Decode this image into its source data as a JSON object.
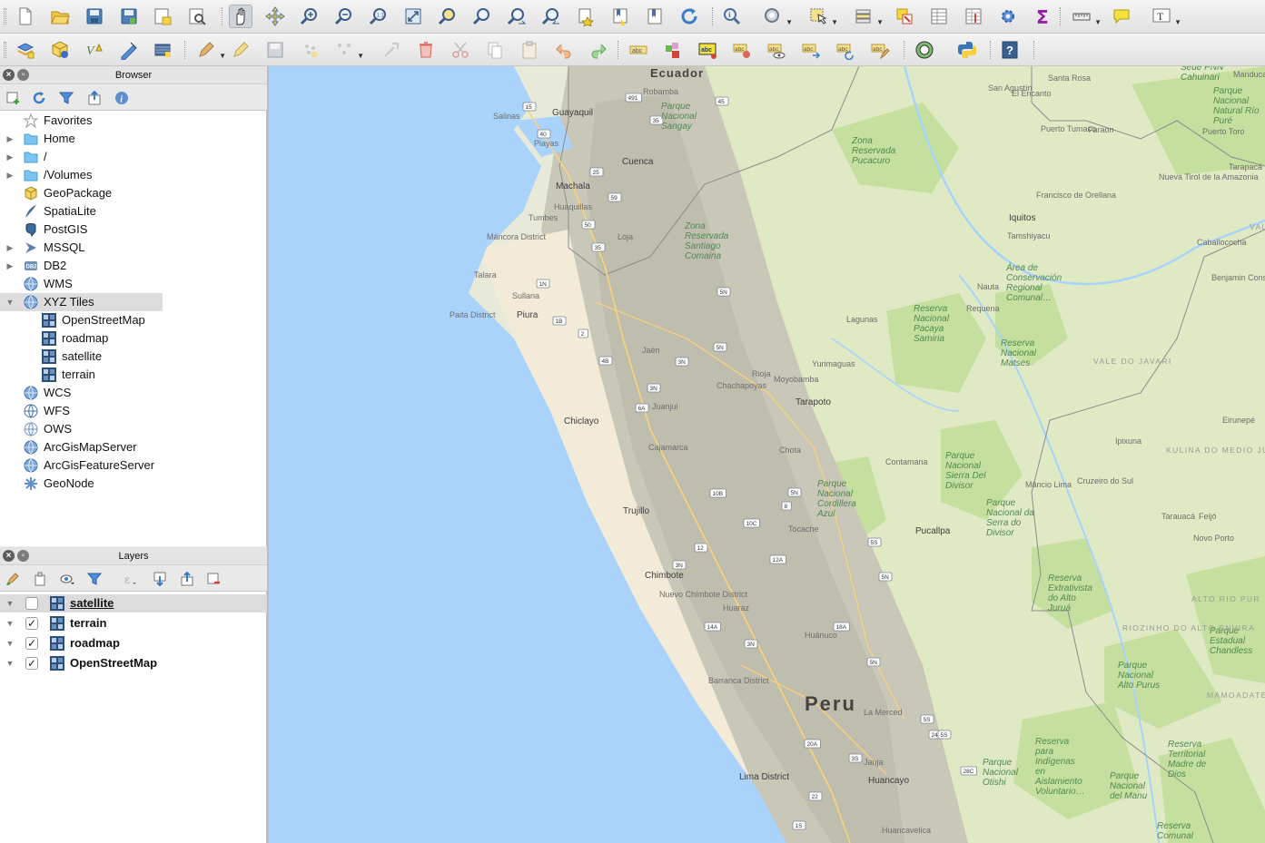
{
  "browser_panel": {
    "title": "Browser",
    "items": [
      {
        "label": "Favorites",
        "icon": "star-icon",
        "expandable": false
      },
      {
        "label": "Home",
        "icon": "folder-icon",
        "expandable": true
      },
      {
        "label": "/",
        "icon": "folder-icon",
        "expandable": true
      },
      {
        "label": "/Volumes",
        "icon": "folder-icon",
        "expandable": true
      },
      {
        "label": "GeoPackage",
        "icon": "geopackage-icon",
        "expandable": false
      },
      {
        "label": "SpatiaLite",
        "icon": "spatialite-icon",
        "expandable": false
      },
      {
        "label": "PostGIS",
        "icon": "postgis-icon",
        "expandable": false
      },
      {
        "label": "MSSQL",
        "icon": "mssql-icon",
        "expandable": true
      },
      {
        "label": "DB2",
        "icon": "db2-icon",
        "expandable": true
      },
      {
        "label": "WMS",
        "icon": "globe-icon",
        "expandable": false
      },
      {
        "label": "XYZ Tiles",
        "icon": "globe-icon",
        "expandable": true,
        "expanded": true,
        "selected": true
      },
      {
        "label": "OpenStreetMap",
        "icon": "tile-layer-icon",
        "child": true
      },
      {
        "label": "roadmap",
        "icon": "tile-layer-icon",
        "child": true
      },
      {
        "label": "satellite",
        "icon": "tile-layer-icon",
        "child": true
      },
      {
        "label": "terrain",
        "icon": "tile-layer-icon",
        "child": true
      },
      {
        "label": "WCS",
        "icon": "globe-icon",
        "expandable": false
      },
      {
        "label": "WFS",
        "icon": "globe-icon",
        "expandable": false
      },
      {
        "label": "OWS",
        "icon": "globe-icon",
        "expandable": false
      },
      {
        "label": "ArcGisMapServer",
        "icon": "globe-icon",
        "expandable": false
      },
      {
        "label": "ArcGisFeatureServer",
        "icon": "globe-icon",
        "expandable": false
      },
      {
        "label": "GeoNode",
        "icon": "geonode-icon",
        "expandable": false
      }
    ]
  },
  "layers_panel": {
    "title": "Layers",
    "layers": [
      {
        "label": "satellite",
        "checked": false,
        "selected": true
      },
      {
        "label": "terrain",
        "checked": true,
        "selected": false
      },
      {
        "label": "roadmap",
        "checked": true,
        "selected": false
      },
      {
        "label": "OpenStreetMap",
        "checked": true,
        "selected": false
      }
    ]
  },
  "map": {
    "country_label": "Peru",
    "country_label_north": "Ecuador",
    "colors": {
      "ocean": "#aad3fb",
      "land": "#e8ead9",
      "forest": "#c5df9e",
      "mountains": "#c9c7b8",
      "desert": "#f1ebd7"
    },
    "cities": [
      "Guayaquil",
      "Salinas",
      "Playas",
      "Cuenca",
      "Machala",
      "Tumbes",
      "Máncora District",
      "Talara",
      "Sullana",
      "Piura",
      "Paita District",
      "Loja",
      "Jaén",
      "Chiclayo",
      "Cajamarca",
      "Chachapoyas",
      "Moyobamba",
      "Tarapoto",
      "Rioja",
      "Trujillo",
      "Chimbote",
      "Nuevo Chimbote District",
      "Huaraz",
      "Huánuco",
      "Barranca District",
      "Lima District",
      "Huancayo",
      "Jauja",
      "La Merced",
      "Huancavelica",
      "Iquitos",
      "Nauta",
      "Requena",
      "Lagunas",
      "Yurimaguas",
      "Juanjuí",
      "Contamana",
      "Pucallpa",
      "Tocache",
      "Santa Rosa",
      "San Agustín",
      "El Encanto",
      "Puerto Tumaco",
      "Faraon",
      "Francisco de Orellana",
      "Nueva Tirol de la Amazonia",
      "Tamshiyacu",
      "Caballococha",
      "Benjamin Constant",
      "Tarapacá",
      "Puerto Toro",
      "Manduca",
      "Eirunepé",
      "Ipixuna",
      "Mâncio Lima",
      "Cruzeiro do Sul",
      "Tarauacá",
      "Feijó",
      "Novo Porto",
      "Robamba",
      "Huaquillas",
      "Chota",
      "Juanjui"
    ],
    "parks": [
      "Parque Nacional Sangay",
      "Zona Reservada Pucacuro",
      "Zona Reservada Santiago Comaina",
      "Reserva Nacional Pacaya Samiria",
      "Reserva Nacional Matses",
      "Área de Conservación Regional Comunal…",
      "Parque Nacional Cordillera Azul",
      "Parque Nacional Sierra Del Divisor",
      "Parque Nacional da Serra do Divisor",
      "Reserva Extrativista do Alto Juruá",
      "Parque Estadual Chandless",
      "Parque Nacional Alto Purus",
      "Reserva para Indígenas en Aislamiento Voluntario…",
      "Parque Nacional Otishi",
      "Reserva Territorial Madre de Dios",
      "Parque Nacional del Manu",
      "Reserva Comunal",
      "Seue PNN Cahuinari",
      "Parque Nacional Natural Río Puré"
    ],
    "regions": [
      "VALE DO JAVARI",
      "KULINA DO MEDIO JURUA",
      "ALTO RIO PUR",
      "RIOZINHO DO ALTO ENVIRA",
      "MAMOADATE",
      "VAL"
    ],
    "road_shields": [
      "15",
      "40",
      "491",
      "35",
      "45",
      "25",
      "59",
      "50",
      "35",
      "1N",
      "1B",
      "2",
      "5N",
      "3N",
      "4B",
      "6A",
      "3N",
      "5N",
      "10B",
      "10C",
      "12A",
      "12",
      "3N",
      "14A",
      "18A",
      "3N",
      "5N",
      "5N",
      "5S",
      "24A",
      "5S",
      "20A",
      "3S",
      "22",
      "28C",
      "5N",
      "5S",
      "1S",
      "8"
    ]
  },
  "toolbar": {
    "row1": [
      "new-project-icon",
      "open-project-icon",
      "save-project-icon",
      "save-as-icon",
      "new-print-layout-icon",
      "layout-manager-icon",
      "pan-map-icon",
      "pan-to-selection-icon",
      "zoom-in-icon",
      "zoom-out-icon",
      "zoom-native-icon",
      "zoom-full-icon",
      "zoom-to-selection-icon",
      "zoom-to-layer-icon",
      "zoom-last-icon",
      "zoom-next-icon",
      "new-spatial-bookmark-icon",
      "show-bookmarks-icon",
      "show-bookmarks-panel-icon",
      "refresh-icon",
      "identify-icon",
      "run-action-icon",
      "select-features-icon",
      "select-by-value-icon",
      "deselect-icon",
      "attribute-table-icon",
      "field-calculator-icon",
      "processing-toolbox-icon",
      "statistical-summary-icon",
      "measure-line-icon",
      "map-tips-icon",
      "text-annotation-icon"
    ],
    "row2": [
      "data-source-manager-icon",
      "new-geopackage-layer-icon",
      "new-shapefile-layer-icon",
      "new-temporary-layer-icon",
      "new-virtual-layer-icon",
      "digitize-icon",
      "toggle-editing-icon",
      "save-edits-icon",
      "add-feature-icon",
      "vertex-tool-icon",
      "modify-attributes-icon",
      "delete-selected-icon",
      "cut-features-icon",
      "copy-features-icon",
      "paste-features-icon",
      "undo-icon",
      "redo-icon",
      "label-tool-icon",
      "layer-labeling-icon",
      "highlight-labels-icon",
      "pin-labels-icon",
      "show-hide-labels-icon",
      "move-label-icon",
      "rotate-label-icon",
      "change-label-icon",
      "osm-icon",
      "python-console-icon",
      "help-icon"
    ]
  }
}
